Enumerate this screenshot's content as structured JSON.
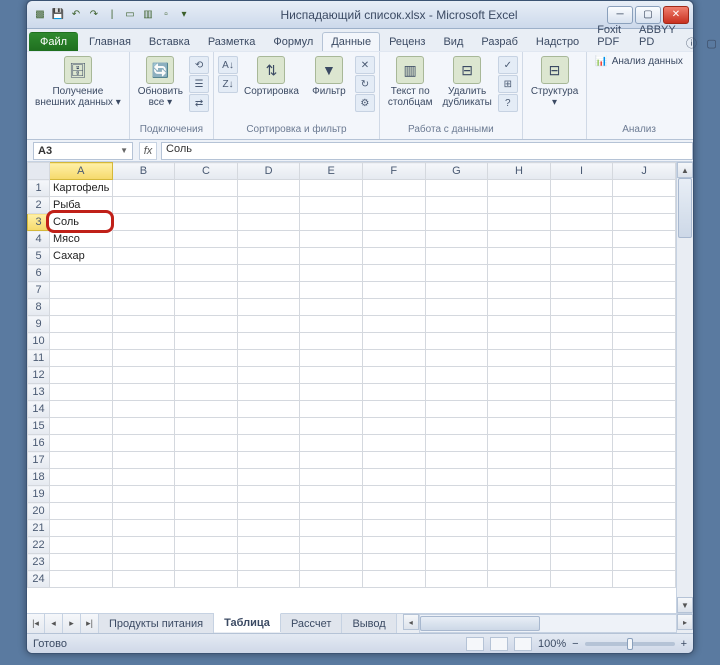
{
  "title": "Ниспадающий список.xlsx - Microsoft Excel",
  "qat_tips": [
    "save",
    "undo",
    "redo",
    "print",
    "preview",
    "new",
    "open"
  ],
  "tabs": {
    "file": "Файл",
    "items": [
      "Главная",
      "Вставка",
      "Разметка",
      "Формул",
      "Данные",
      "Реценз",
      "Вид",
      "Разраб",
      "Надстро",
      "Foxit PDF",
      "ABBYY PD"
    ],
    "active_index": 4
  },
  "ribbon": {
    "g1": {
      "btn": "Получение\nвнешних данных ▾",
      "label": ""
    },
    "g2": {
      "btn": "Обновить\nвсе ▾",
      "label": "Подключения"
    },
    "g3": {
      "btn": "Сортировка",
      "filter": "Фильтр",
      "label": "Сортировка и фильтр"
    },
    "g4": {
      "b1": "Текст по\nстолбцам",
      "b2": "Удалить\nдубликаты",
      "label": "Работа с данными"
    },
    "g5": {
      "btn": "Структура\n▾",
      "label": ""
    },
    "g6": {
      "btn": "Анализ данных",
      "label": "Анализ"
    }
  },
  "namebox": "A3",
  "formula": "Соль",
  "columns": [
    "A",
    "B",
    "C",
    "D",
    "E",
    "F",
    "G",
    "H",
    "I",
    "J"
  ],
  "rows": 24,
  "cells": {
    "A1": "Картофель",
    "A2": "Рыба",
    "A3": "Соль",
    "A4": "Мясо",
    "A5": "Сахар"
  },
  "selected": {
    "row": 3,
    "col": "A"
  },
  "sheets": [
    "Продукты питания",
    "Таблица",
    "Рассчет",
    "Вывод"
  ],
  "active_sheet": 1,
  "status": "Готово",
  "zoom": "100%"
}
